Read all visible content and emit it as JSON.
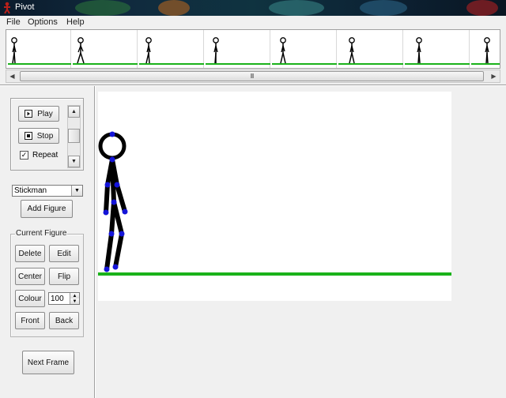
{
  "window": {
    "title": "Pivot"
  },
  "menu": {
    "items": [
      "File",
      "Options",
      "Help"
    ]
  },
  "timeline": {
    "frame_count": 8,
    "scrollbar_grip": "III"
  },
  "playback": {
    "play_label": "Play",
    "stop_label": "Stop",
    "repeat_label": "Repeat",
    "repeat_checked": true,
    "check_glyph": "✓"
  },
  "figure_select": {
    "selected": "Stickman"
  },
  "add_figure_label": "Add Figure",
  "current_figure": {
    "legend": "Current Figure",
    "delete_label": "Delete",
    "edit_label": "Edit",
    "center_label": "Center",
    "flip_label": "Flip",
    "colour_label": "Colour",
    "colour_value": "100",
    "front_label": "Front",
    "back_label": "Back"
  },
  "next_frame_label": "Next Frame",
  "colors": {
    "ground": "#1ab21a",
    "handle": "#1414d8",
    "stick": "#000000",
    "canvas_bg": "#ffffff"
  },
  "icons": {
    "app": "stickman-app-icon",
    "play": "play-icon",
    "stop": "stop-icon",
    "scroll_up": "chevron-up-icon",
    "scroll_down": "chevron-down-icon",
    "dropdown": "chevron-down-icon",
    "scroll_left": "chevron-left-icon",
    "scroll_right": "chevron-right-icon"
  }
}
